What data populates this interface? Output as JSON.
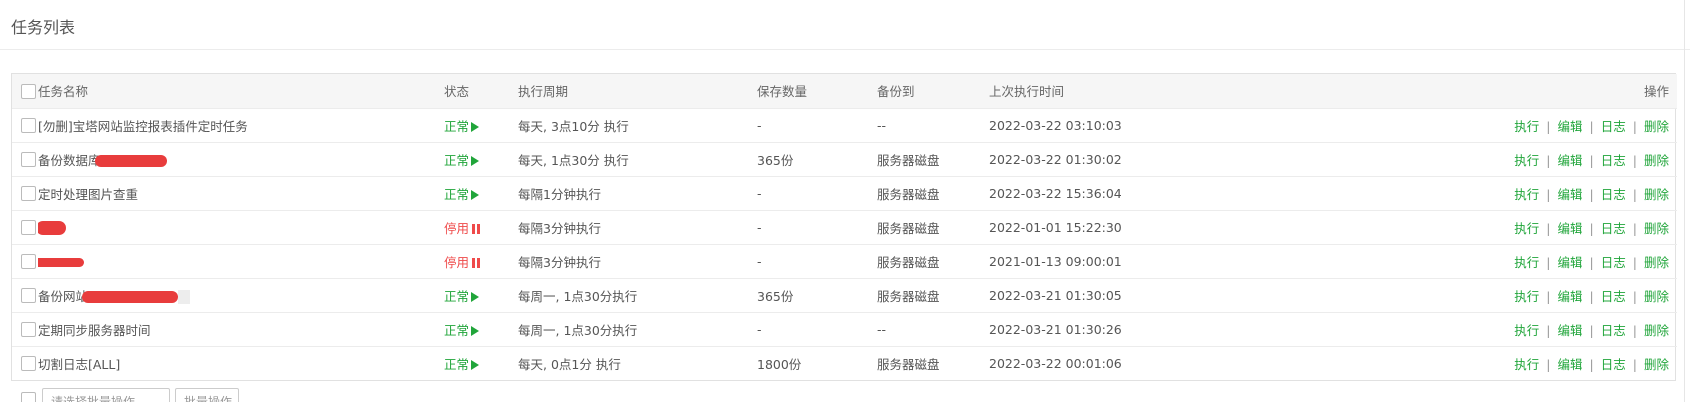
{
  "page": {
    "title": "任务列表"
  },
  "colors": {
    "accent_green": "#20a53a",
    "stop_red": "#ef4a4a"
  },
  "table": {
    "columns": {
      "name": "任务名称",
      "status": "状态",
      "cycle": "执行周期",
      "save_count": "保存数量",
      "backup_to": "备份到",
      "last_run": "上次执行时间",
      "ops": "操作"
    },
    "rows": [
      {
        "name": "[勿删]宝塔网站监控报表插件定时任务",
        "status": "正常",
        "status_type": "ok",
        "cycle": "每天, 3点10分 执行",
        "save_count": "-",
        "backup_to": "--",
        "last_run": "2022-03-22 03:10:03"
      },
      {
        "name": "备份数据库",
        "status": "正常",
        "status_type": "ok",
        "cycle": "每天, 1点30分 执行",
        "save_count": "365份",
        "backup_to": "服务器磁盘",
        "last_run": "2022-03-22 01:30:02"
      },
      {
        "name": "定时处理图片查重",
        "status": "正常",
        "status_type": "ok",
        "cycle": "每隔1分钟执行",
        "save_count": "-",
        "backup_to": "服务器磁盘",
        "last_run": "2022-03-22 15:36:04"
      },
      {
        "name": "",
        "status": "停用",
        "status_type": "stop",
        "cycle": "每隔3分钟执行",
        "save_count": "-",
        "backup_to": "服务器磁盘",
        "last_run": "2022-01-01 15:22:30"
      },
      {
        "name": "",
        "status": "停用",
        "status_type": "stop",
        "cycle": "每隔3分钟执行",
        "save_count": "-",
        "backup_to": "服务器磁盘",
        "last_run": "2021-01-13 09:00:01"
      },
      {
        "name": "备份网站",
        "status": "正常",
        "status_type": "ok",
        "cycle": "每周一, 1点30分执行",
        "save_count": "365份",
        "backup_to": "服务器磁盘",
        "last_run": "2022-03-21 01:30:05"
      },
      {
        "name": "定期同步服务器时间",
        "status": "正常",
        "status_type": "ok",
        "cycle": "每周一, 1点30分执行",
        "save_count": "-",
        "backup_to": "--",
        "last_run": "2022-03-21 01:30:26"
      },
      {
        "name": "切割日志[ALL]",
        "status": "正常",
        "status_type": "ok",
        "cycle": "每天, 0点1分 执行",
        "save_count": "1800份",
        "backup_to": "服务器磁盘",
        "last_run": "2022-03-22 00:01:06"
      }
    ],
    "ops": {
      "run": "执行",
      "edit": "编辑",
      "log": "日志",
      "delete": "删除",
      "separator": "|"
    }
  },
  "footer": {
    "batch_select": "请选择批量操作",
    "batch_button": "批量操作"
  }
}
